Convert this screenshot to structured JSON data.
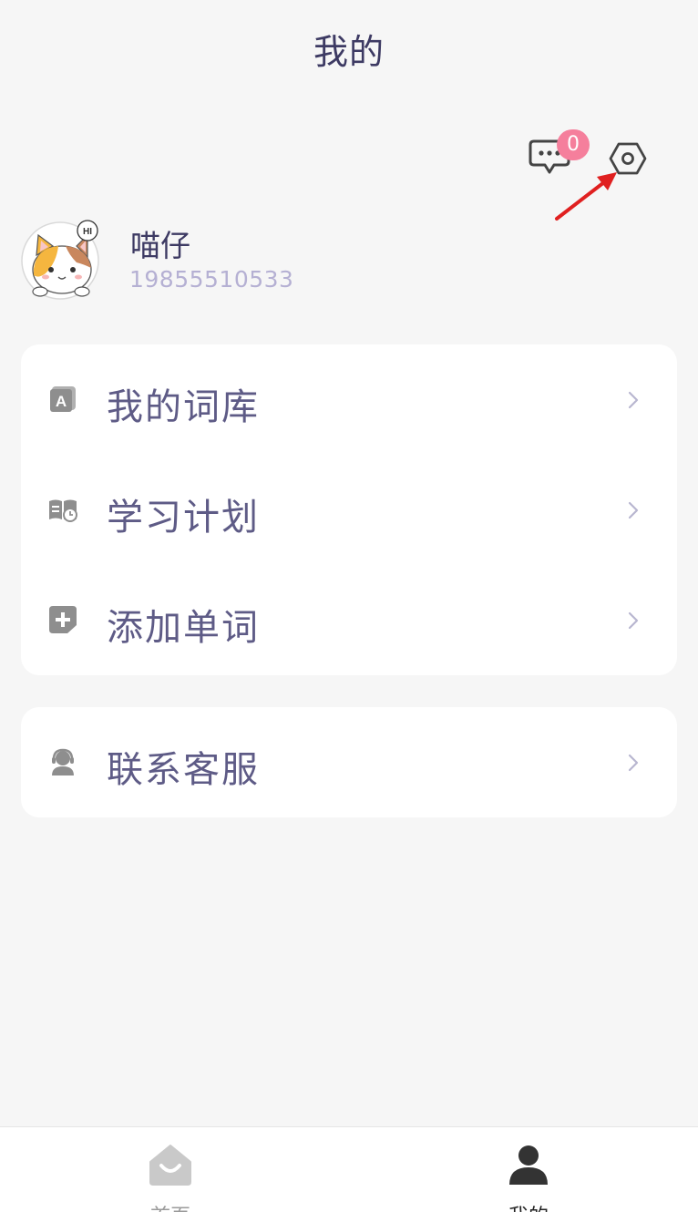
{
  "header": {
    "title": "我的"
  },
  "toolbar": {
    "message_icon": "chat-bubble-icon",
    "message_badge": "0",
    "settings_icon": "hexagon-gear-icon"
  },
  "user": {
    "name": "喵仔",
    "phone": "19855510533",
    "avatar": "cartoon-cat-hi"
  },
  "menu": {
    "items": [
      {
        "icon": "book-a-icon",
        "label": "我的词库"
      },
      {
        "icon": "book-clock-icon",
        "label": "学习计划"
      },
      {
        "icon": "add-square-icon",
        "label": "添加单词"
      }
    ]
  },
  "support": {
    "icon": "headset-person-icon",
    "label": "联系客服"
  },
  "tabs": [
    {
      "icon": "home-icon",
      "label": "首页",
      "active": false
    },
    {
      "icon": "person-icon",
      "label": "我的",
      "active": true
    }
  ],
  "colors": {
    "title": "#3d3a63",
    "label": "#5e5b86",
    "phone": "#b5b0d3",
    "badge": "#f57f9c",
    "background": "#f6f6f6",
    "annotation_arrow": "#e02020"
  }
}
